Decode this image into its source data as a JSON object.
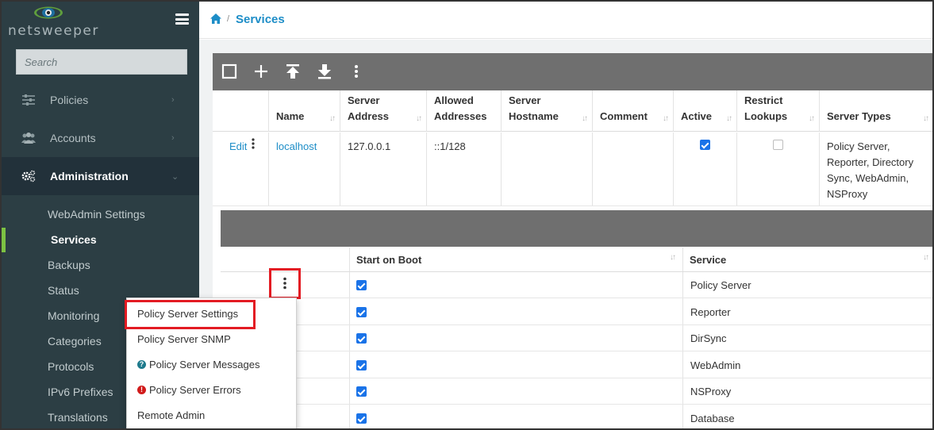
{
  "brand": {
    "name": "netsweeper"
  },
  "search": {
    "placeholder": "Search"
  },
  "sidebar": {
    "nav": [
      {
        "label": "Policies"
      },
      {
        "label": "Accounts"
      },
      {
        "label": "Administration"
      }
    ],
    "sub_items": [
      {
        "label": "WebAdmin Settings"
      },
      {
        "label": "Services"
      },
      {
        "label": "Backups"
      },
      {
        "label": "Status"
      },
      {
        "label": "Monitoring"
      },
      {
        "label": "Categories"
      },
      {
        "label": "Protocols"
      },
      {
        "label": "IPv6 Prefixes"
      },
      {
        "label": "Translations"
      }
    ]
  },
  "breadcrumb": {
    "separator": "/",
    "title": "Services"
  },
  "table": {
    "headers": {
      "name": "Name",
      "server_address": "Server Address",
      "allowed_addresses": "Allowed Addresses",
      "server_hostname": "Server Hostname",
      "comment": "Comment",
      "active": "Active",
      "restrict_lookups": "Restrict Lookups",
      "server_types": "Server Types"
    },
    "rows": [
      {
        "edit": "Edit",
        "name": "localhost",
        "server_address": "127.0.0.1",
        "allowed_addresses": "::1/128",
        "server_hostname": "",
        "comment": "",
        "active": true,
        "restrict_lookups": false,
        "server_types": "Policy Server, Reporter, Directory Sync, WebAdmin, NSProxy"
      }
    ]
  },
  "services_table": {
    "headers": {
      "start_on_boot": "Start on Boot",
      "service": "Service"
    },
    "rows": [
      {
        "start_on_boot": true,
        "service": "Policy Server"
      },
      {
        "start_on_boot": true,
        "service": "Reporter"
      },
      {
        "start_on_boot": true,
        "service": "DirSync"
      },
      {
        "start_on_boot": true,
        "service": "WebAdmin"
      },
      {
        "start_on_boot": true,
        "service": "NSProxy"
      },
      {
        "start_on_boot": true,
        "service": "Database"
      }
    ]
  },
  "context_menu": {
    "items": [
      {
        "label": "Policy Server Settings",
        "icon": null
      },
      {
        "label": "Policy Server SNMP",
        "icon": null
      },
      {
        "label": "Policy Server Messages",
        "icon": "help-circle-icon"
      },
      {
        "label": "Policy Server Errors",
        "icon": "error-circle-icon"
      },
      {
        "label": "Remote Admin",
        "icon": null
      }
    ]
  },
  "colors": {
    "sidebar_bg": "#2c3e44",
    "active_nav_bg": "#22313a",
    "accent_green": "#7dc243",
    "link_blue": "#1d8dc7",
    "toolbar_gray": "#6f6f6f",
    "highlight_red": "#e31b23"
  }
}
